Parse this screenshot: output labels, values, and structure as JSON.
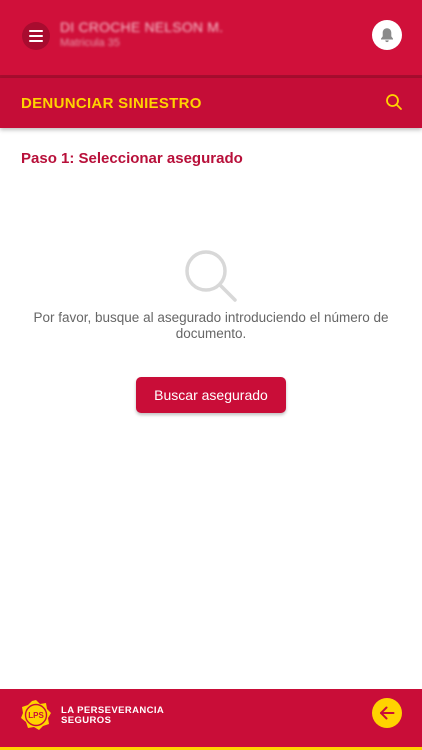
{
  "header": {
    "user_name": "DI CROCHE NELSON M.",
    "user_sub": "Matricula 35",
    "menu_icon": "hamburger-icon",
    "bell_icon": "bell-icon"
  },
  "titlebar": {
    "title": "DENUNCIAR SINIESTRO",
    "search_icon": "search-icon"
  },
  "content": {
    "step_title": "Paso 1: Seleccionar asegurado",
    "empty_icon": "magnifier-icon",
    "instructions": "Por favor, busque al asegurado introduciendo el número de documento.",
    "button_label": "Buscar asegurado"
  },
  "footer": {
    "logo_text": "LPS",
    "brand_line1": "LA PERSEVERANCIA",
    "brand_line2": "SEGUROS",
    "back_icon": "arrow-left-icon"
  },
  "colors": {
    "primary": "#d0103a",
    "accent": "#ffd300",
    "text_muted": "#666666"
  }
}
